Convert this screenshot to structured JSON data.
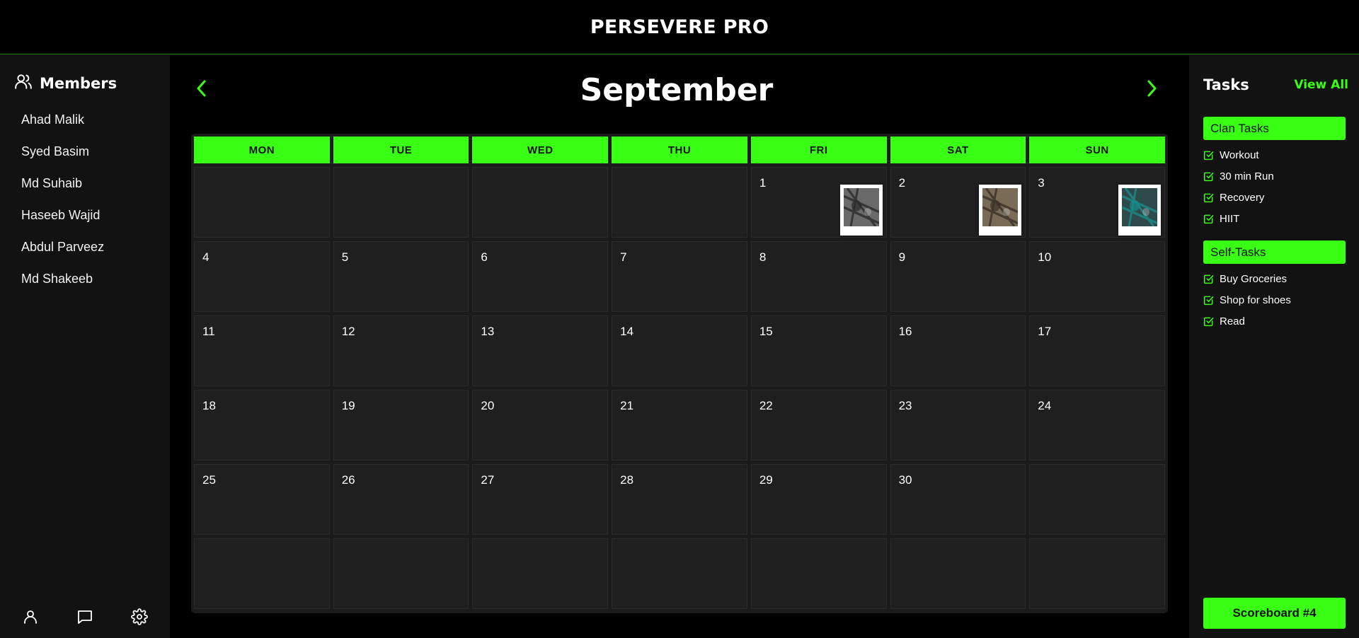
{
  "header": {
    "title": "PERSEVERE PRO"
  },
  "colors": {
    "accent": "#39ff14",
    "background": "#000000",
    "panel": "#121212",
    "cell": "#1f1f1f"
  },
  "members": {
    "title": "Members",
    "icon": "users-icon",
    "list": [
      "Ahad Malik",
      "Syed Basim",
      "Md Suhaib",
      "Haseeb Wajid",
      "Abdul Parveez",
      "Md Shakeeb"
    ]
  },
  "sidebar_footer": {
    "icons": [
      "profile-icon",
      "chat-icon",
      "settings-icon"
    ]
  },
  "calendar": {
    "month": "September",
    "prev_icon": "chevron-left-icon",
    "next_icon": "chevron-right-icon",
    "weekdays": [
      "MON",
      "TUE",
      "WED",
      "THU",
      "FRI",
      "SAT",
      "SUN"
    ],
    "cells": [
      "",
      "",
      "",
      "",
      "1",
      "2",
      "3",
      "4",
      "5",
      "6",
      "7",
      "8",
      "9",
      "10",
      "11",
      "12",
      "13",
      "14",
      "15",
      "16",
      "17",
      "18",
      "19",
      "20",
      "21",
      "22",
      "23",
      "24",
      "25",
      "26",
      "27",
      "28",
      "29",
      "30",
      "",
      "",
      "",
      "",
      "",
      "",
      "",
      ""
    ],
    "photo_days": [
      "1",
      "2",
      "3"
    ]
  },
  "tasks": {
    "title": "Tasks",
    "view_all": "View All",
    "clan": {
      "label": "Clan Tasks",
      "items": [
        "Workout",
        "30 min Run",
        "Recovery",
        "HIIT"
      ]
    },
    "self": {
      "label": "Self-Tasks",
      "items": [
        "Buy Groceries",
        "Shop for shoes",
        "Read"
      ]
    },
    "scoreboard": "Scoreboard #4"
  }
}
